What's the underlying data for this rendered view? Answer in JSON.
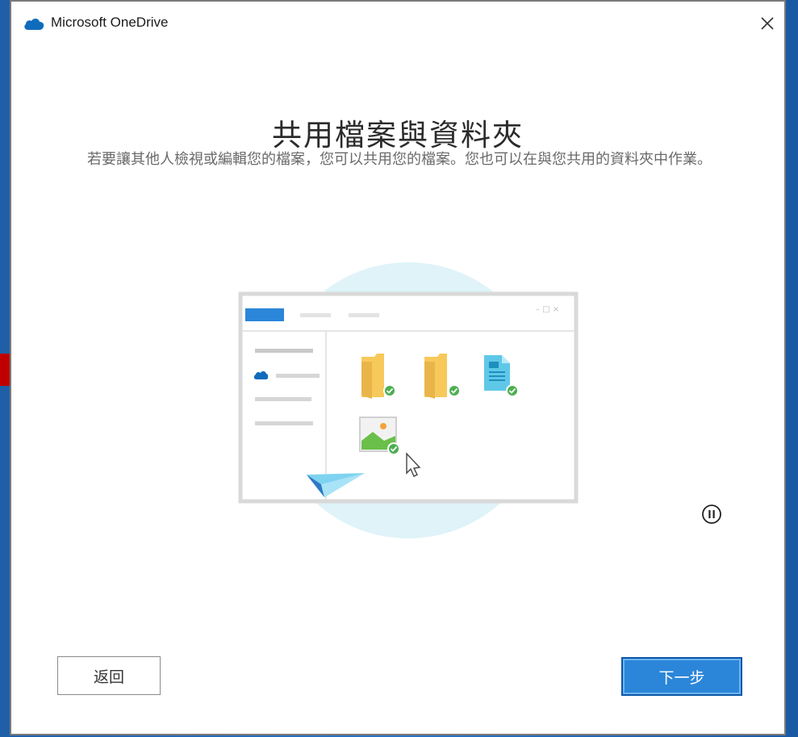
{
  "window": {
    "title": "Microsoft OneDrive",
    "close_symbol": "✕",
    "app_icon": "onedrive-cloud-icon"
  },
  "main": {
    "heading": "共用檔案與資料夾",
    "description": "若要讓其他人檢視或編輯您的檔案，您可以共用您的檔案。您也可以在與您共用的資料夾中作業。"
  },
  "illustration": {
    "window_controls": "–  □  ×",
    "items": [
      {
        "icon": "folder-synced-icon"
      },
      {
        "icon": "folder-synced-icon"
      },
      {
        "icon": "document-synced-icon"
      },
      {
        "icon": "image-synced-icon"
      }
    ]
  },
  "controls": {
    "pause_icon": "pause-circle-icon"
  },
  "footer": {
    "back_label": "返回",
    "next_label": "下一步"
  },
  "colors": {
    "accent": "#2b86d9",
    "accent_border": "#0a58a8",
    "onedrive_blue": "#0f6cbd",
    "circle_bg": "#dff3f8",
    "folder_yellow": "#f7c95a",
    "check_green": "#4caf50",
    "annotation_red": "#c00000"
  }
}
